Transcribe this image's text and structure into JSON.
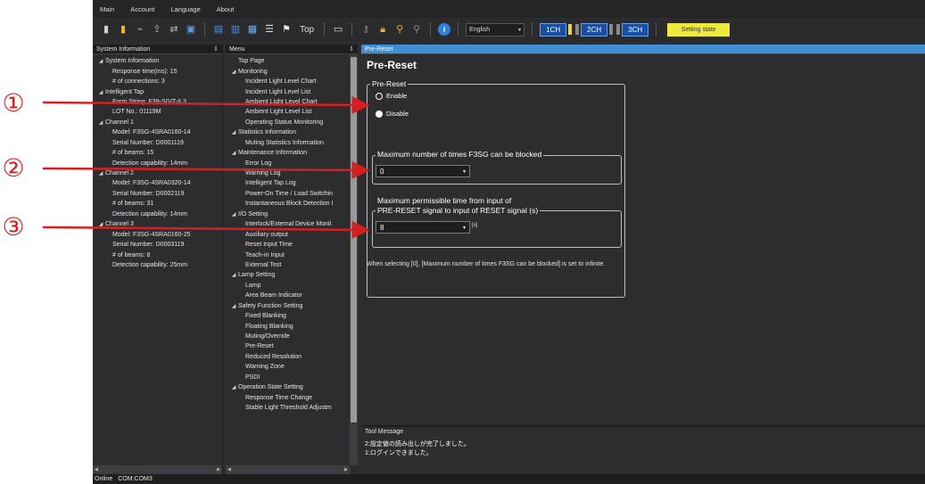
{
  "menubar": {
    "items": [
      "Main",
      "Account",
      "Language",
      "About"
    ]
  },
  "toolbar": {
    "top_label": "Top",
    "language_value": "English",
    "channels": [
      "1CH",
      "2CH",
      "3CH"
    ],
    "setting_state_label": "Setting state"
  },
  "system_panel": {
    "header": "System Information",
    "pin_icon": "⇩",
    "rows": [
      {
        "indent": 1,
        "text": "System Information",
        "expander": true
      },
      {
        "indent": 2,
        "text": "Response time(ms): 15"
      },
      {
        "indent": 2,
        "text": "# of connections: 3"
      },
      {
        "indent": 1,
        "text": "Intelligent Tap",
        "expander": true
      },
      {
        "indent": 2,
        "text": "Form String: F39-SGIT-IL3"
      },
      {
        "indent": 2,
        "text": "LOT No.: 01119M"
      },
      {
        "indent": 1,
        "text": "Channel 1",
        "expander": true
      },
      {
        "indent": 2,
        "text": "Model: F3SG-4SRA0160-14"
      },
      {
        "indent": 2,
        "text": "Serial Number: D0001119"
      },
      {
        "indent": 2,
        "text": "# of beams: 15"
      },
      {
        "indent": 2,
        "text": "Detection capability: 14mm"
      },
      {
        "indent": 1,
        "text": "Channel 2",
        "expander": true
      },
      {
        "indent": 2,
        "text": "Model: F3SG-4SRA0320-14"
      },
      {
        "indent": 2,
        "text": "Serial Number: D0002119"
      },
      {
        "indent": 2,
        "text": "# of beams: 31"
      },
      {
        "indent": 2,
        "text": "Detection capability: 14mm"
      },
      {
        "indent": 1,
        "text": "Channel 3",
        "expander": true
      },
      {
        "indent": 2,
        "text": "Model: F3SG-4SRA0160-25"
      },
      {
        "indent": 2,
        "text": "Serial Number: D0003119"
      },
      {
        "indent": 2,
        "text": "# of beams: 8"
      },
      {
        "indent": 2,
        "text": "Detection capability: 25mm"
      }
    ]
  },
  "menu_panel": {
    "header": "Menu",
    "pin_icon": "⇩",
    "rows": [
      {
        "indent": 1,
        "text": "Top Page"
      },
      {
        "indent": 1,
        "text": "Monitoring",
        "expander": true
      },
      {
        "indent": 2,
        "text": "Incident Light Level Chart"
      },
      {
        "indent": 2,
        "text": "Incident Light Level List"
      },
      {
        "indent": 2,
        "text": "Ambient Light Level Chart"
      },
      {
        "indent": 2,
        "text": "Ambient Light Level List"
      },
      {
        "indent": 2,
        "text": "Operating Status Monitoring"
      },
      {
        "indent": 1,
        "text": "Statistics Information",
        "expander": true
      },
      {
        "indent": 2,
        "text": "Muting Statistics Information"
      },
      {
        "indent": 1,
        "text": "Maintenance Information",
        "expander": true
      },
      {
        "indent": 2,
        "text": "Error Log"
      },
      {
        "indent": 2,
        "text": "Warning Log"
      },
      {
        "indent": 2,
        "text": "Intelligent Tap Log"
      },
      {
        "indent": 2,
        "text": "Power-On Time / Load Switchin"
      },
      {
        "indent": 2,
        "text": "Instantaneous Block Detection I"
      },
      {
        "indent": 1,
        "text": "I/O Setting",
        "expander": true
      },
      {
        "indent": 2,
        "text": "Interlock/External Device Monit"
      },
      {
        "indent": 2,
        "text": "Auxiliary output"
      },
      {
        "indent": 2,
        "text": "Reset Input Time"
      },
      {
        "indent": 2,
        "text": "Teach-in Input"
      },
      {
        "indent": 2,
        "text": "External Test"
      },
      {
        "indent": 1,
        "text": "Lamp Setting",
        "expander": true
      },
      {
        "indent": 2,
        "text": "Lamp"
      },
      {
        "indent": 2,
        "text": "Area Beam Indicator"
      },
      {
        "indent": 1,
        "text": "Safety Function Setting",
        "expander": true
      },
      {
        "indent": 2,
        "text": "Fixed Blanking"
      },
      {
        "indent": 2,
        "text": "Floating Blanking"
      },
      {
        "indent": 2,
        "text": "Muting/Override"
      },
      {
        "indent": 2,
        "text": "Pre-Reset"
      },
      {
        "indent": 2,
        "text": "Reduced Resolution"
      },
      {
        "indent": 2,
        "text": "Warning Zone"
      },
      {
        "indent": 2,
        "text": "PSDI"
      },
      {
        "indent": 1,
        "text": "Operation State Setting",
        "expander": true
      },
      {
        "indent": 2,
        "text": "Response Time Change"
      },
      {
        "indent": 2,
        "text": "Stable Light Threshold Adjustm"
      }
    ]
  },
  "content": {
    "tab_label": "Pre-Reset",
    "title": "Pre-Reset",
    "pre_reset_group": {
      "legend": "Pre-Reset",
      "enable_label": "Enable",
      "disable_label": "Disable",
      "selected": "Enable"
    },
    "max_block_group": {
      "legend": "Maximum number of times F3SG can be blocked",
      "value": "0"
    },
    "max_time_group": {
      "legend_line1": "Maximum permissible time from input of",
      "legend_line2": "PRE-RESET signal to input of RESET signal (s)",
      "value": "8",
      "unit": "[s]"
    },
    "note": "When selecting [0], [Maximum number of times F3SG can be blocked] is set to infinite."
  },
  "tool_message": {
    "header": "Tool Message",
    "lines": [
      "2:設定値の読み出しが完了しました。",
      "1:ログインできました。"
    ]
  },
  "statusbar": {
    "status": "Online",
    "port": "COM:COM3"
  },
  "annotations": {
    "markers": [
      "①",
      "②",
      "③"
    ],
    "color": "#d62020"
  },
  "colors": {
    "accent_blue": "#3d8fd6",
    "state_yellow": "#f0ea40",
    "channel_blue": "#1a4fa0"
  }
}
